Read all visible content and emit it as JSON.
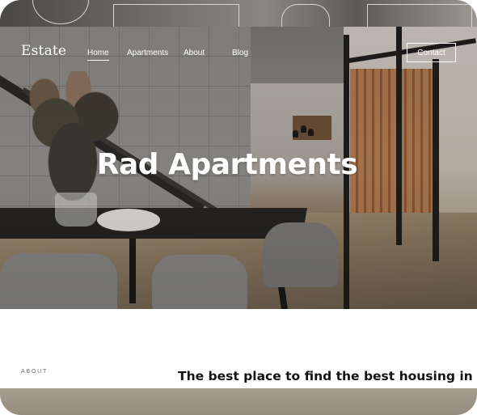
{
  "brand": {
    "logo_text": "Estate"
  },
  "nav": {
    "items": [
      {
        "label": "Home",
        "active": true
      },
      {
        "label": "Apartments",
        "active": false
      },
      {
        "label": "About",
        "active": false
      },
      {
        "label": "Blog",
        "active": false
      }
    ],
    "contact_label": "Contact"
  },
  "hero": {
    "title": "Rad Apartments"
  },
  "about": {
    "label": "ABOUT",
    "heading": "The best place to find the best housing in"
  },
  "colors": {
    "text_on_hero": "#ffffff",
    "heading_dark": "#141414",
    "label_gray": "#6b6b6b"
  }
}
